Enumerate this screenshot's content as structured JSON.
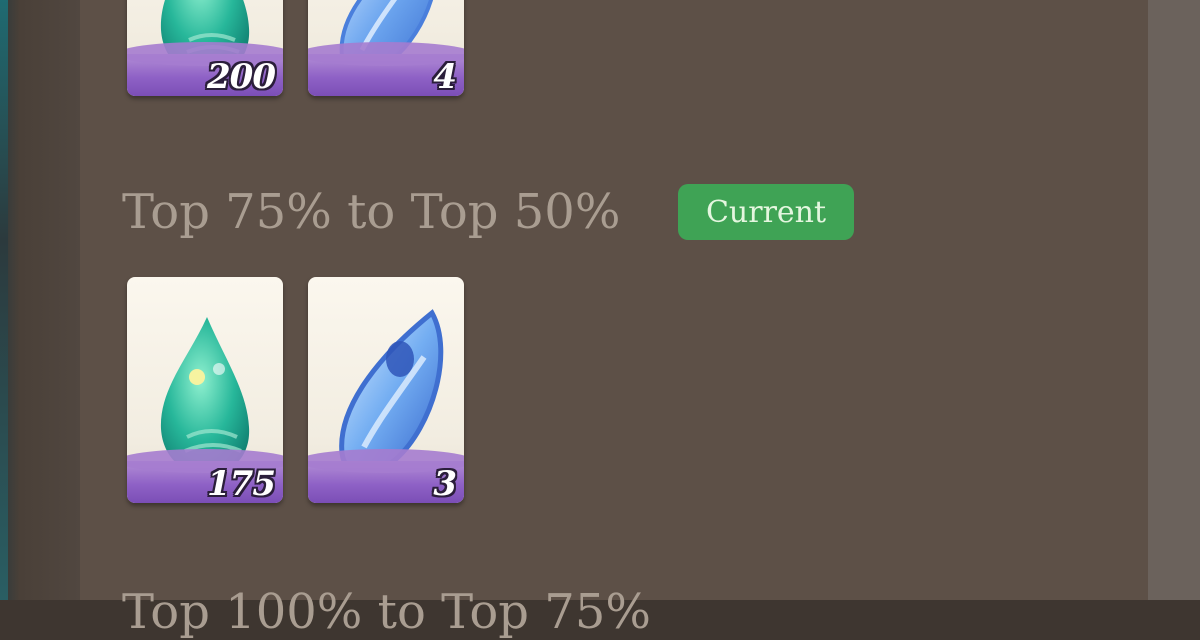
{
  "colors": {
    "panel_bg": "#5d5047",
    "title_text": "#a99d91",
    "badge_bg": "#3fa355",
    "badge_text": "#e4f6df",
    "card_bg": "#fbf7ee",
    "rarity_purple": "#8f62c6"
  },
  "tiers": [
    {
      "title": "",
      "rewards": [
        {
          "icon": "green-leaf-drop-icon",
          "quantity": "200"
        },
        {
          "icon": "blue-crystal-icon",
          "quantity": "4"
        }
      ]
    },
    {
      "title": "Top 75% to Top 50%",
      "badge": "Current",
      "rewards": [
        {
          "icon": "green-leaf-drop-icon",
          "quantity": "175"
        },
        {
          "icon": "blue-crystal-icon",
          "quantity": "3"
        }
      ]
    },
    {
      "title": "Top 100% to Top 75%",
      "rewards": []
    }
  ]
}
